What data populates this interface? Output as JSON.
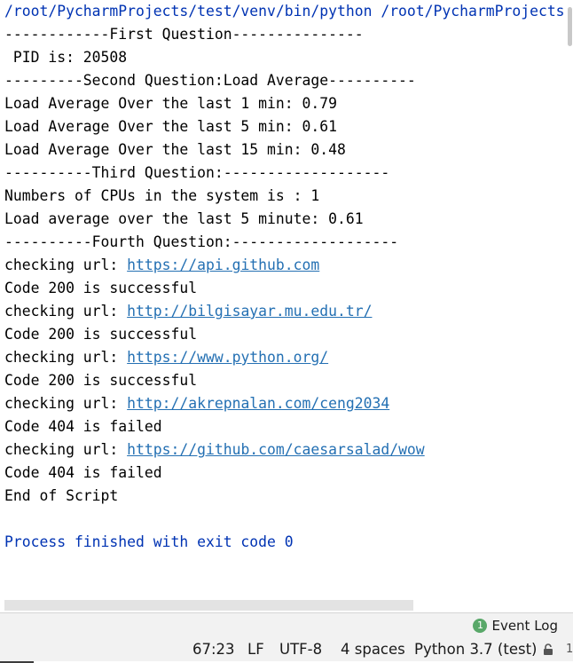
{
  "console": {
    "command": "/root/PycharmProjects/test/venv/bin/python /root/PycharmProjects",
    "lines": [
      "------------First Question---------------",
      " PID is: 20508",
      "---------Second Question:Load Average----------",
      "Load Average Over the last 1 min: 0.79",
      "Load Average Over the last 5 min: 0.61",
      "Load Average Over the last 15 min: 0.48",
      "----------Third Question:-------------------",
      "Numbers of CPUs in the system is : 1",
      "Load average over the last 5 minute: 0.61",
      "----------Fourth Question:-------------------"
    ],
    "checks": [
      {
        "prefix": "checking url: ",
        "url": "https://api.github.com",
        "result": "Code 200 is successful"
      },
      {
        "prefix": "checking url: ",
        "url": "http://bilgisayar.mu.edu.tr/",
        "result": "Code 200 is successful"
      },
      {
        "prefix": "checking url: ",
        "url": "https://www.python.org/",
        "result": "Code 200 is successful"
      },
      {
        "prefix": "checking url: ",
        "url": "http://akrepnalan.com/ceng2034",
        "result": "Code 404 is failed"
      },
      {
        "prefix": "checking url: ",
        "url": "https://github.com/caesarsalad/wow",
        "result": "Code 404 is failed"
      }
    ],
    "end": "End of Script",
    "exit": "Process finished with exit code 0"
  },
  "event_log": {
    "count": "1",
    "label": "Event Log"
  },
  "status": {
    "position": "67:23",
    "line_sep": "LF",
    "encoding": "UTF-8",
    "indent": "4 spaces",
    "interpreter": "Python 3.7 (test)",
    "extra": "1"
  },
  "colors": {
    "command": "#0033b3",
    "link": "#2470b3",
    "badge": "#59a869"
  }
}
